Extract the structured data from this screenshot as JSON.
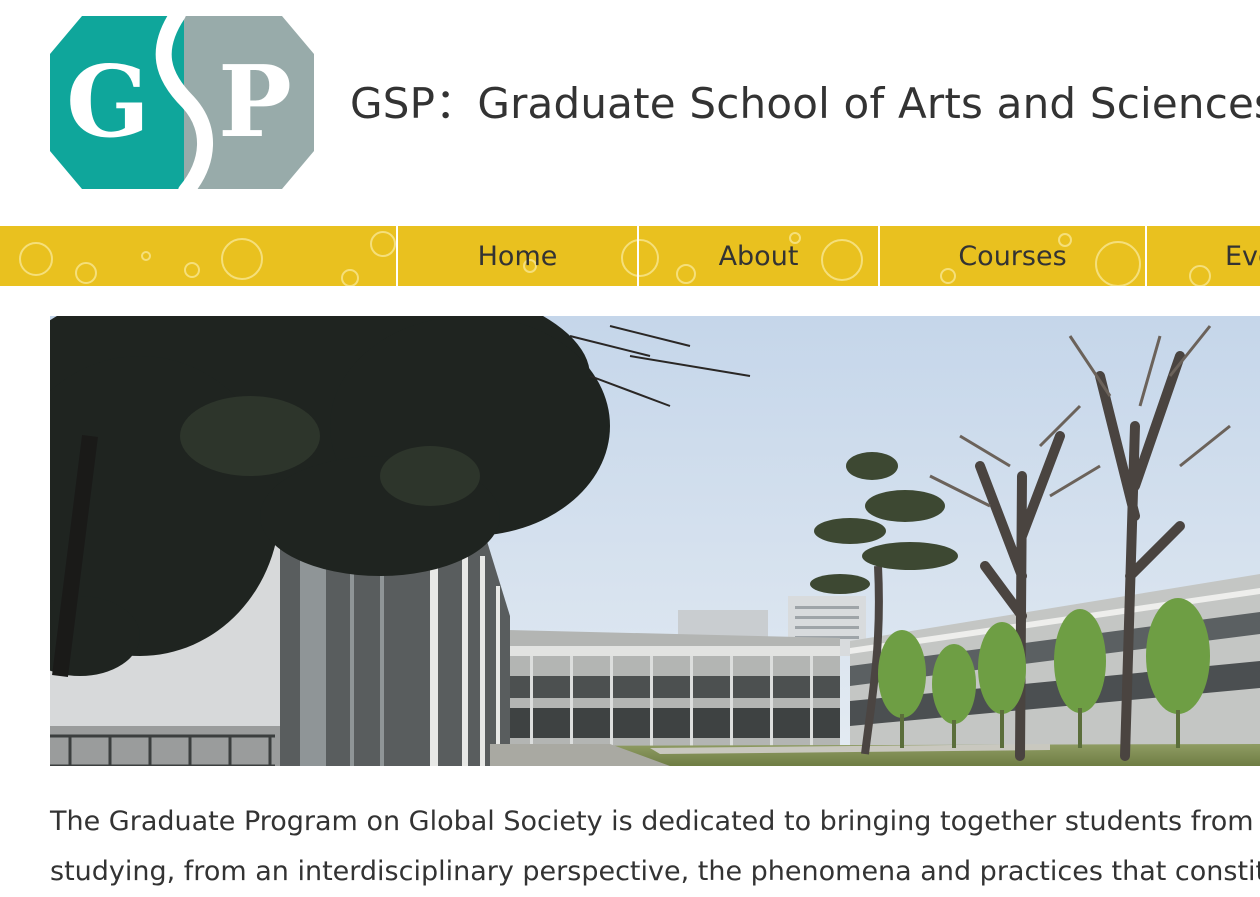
{
  "header": {
    "logo": {
      "letter_left": "G",
      "letter_right": "P",
      "colors": {
        "teal": "#0fa69b",
        "gray": "#98abaa"
      }
    },
    "site_title": "GSP：Graduate School of Arts and Sciences,"
  },
  "nav": {
    "background": "#e9c11f",
    "items": [
      {
        "label": "Home"
      },
      {
        "label": "About"
      },
      {
        "label": "Courses"
      },
      {
        "label": "Eve"
      }
    ]
  },
  "hero": {
    "alt": "Campus buildings and courtyard with trees under a pale blue sky"
  },
  "intro": {
    "lines": [
      "The Graduate Program on Global Society is dedicated to bringing together students from acro",
      "studying, from an interdisciplinary perspective, the phenomena and practices that constitute"
    ]
  }
}
